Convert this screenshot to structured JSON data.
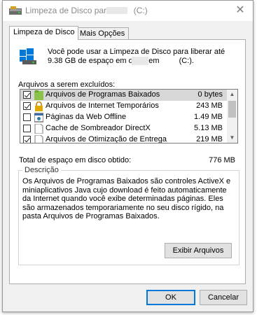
{
  "window": {
    "title": "Limpeza de Disco para",
    "title_suffix": "(C:)",
    "close_glyph": "✕"
  },
  "tabs": [
    {
      "label": "Limpeza de Disco",
      "active": true
    },
    {
      "label": "Mais Opções",
      "active": false
    }
  ],
  "intro": {
    "text_part1": "Você pode usar a Limpeza de Disco para liberar até 9.38 GB de espaço em disco em",
    "text_part2": "(C:)."
  },
  "files_section_label": "Arquivos a serem excluídos:",
  "files": [
    {
      "name": "Arquivos de Programas Baixados",
      "size": "0 bytes",
      "checked": true,
      "icon": "folder-green-icon",
      "selected": true
    },
    {
      "name": "Arquivos de Internet Temporários",
      "size": "243 MB",
      "checked": true,
      "icon": "lock-icon",
      "selected": false
    },
    {
      "name": "Páginas da Web Offline",
      "size": "1.49 MB",
      "checked": false,
      "icon": "offline-pages-icon",
      "selected": false
    },
    {
      "name": "Cache de Sombreador DirectX",
      "size": "5.13 MB",
      "checked": false,
      "icon": "document-icon",
      "selected": false
    },
    {
      "name": "Arquivos de Otimização de Entrega",
      "size": "219 MB",
      "checked": true,
      "icon": "document-icon",
      "selected": false
    }
  ],
  "total": {
    "label": "Total de espaço em disco obtido:",
    "value": "776 MB"
  },
  "description": {
    "title": "Descrição",
    "text": "Os Arquivos de Programas Baixados são controles ActiveX e miniaplicativos Java cujo download é feito automaticamente da Internet quando você exibe determinadas páginas. Eles são armazenados temporariamente no seu disco rígido, na pasta Arquivos de Programas Baixados."
  },
  "buttons": {
    "view_files": "Exibir Arquivos",
    "ok": "OK",
    "cancel": "Cancelar"
  },
  "colors": {
    "accent": "#0078d7",
    "window_bg": "#f0f0f0",
    "selected_row": "#d7d7d7"
  }
}
